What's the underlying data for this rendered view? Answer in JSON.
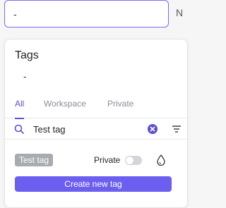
{
  "top_field": {
    "value": "-",
    "next_column_label": "N"
  },
  "tag_panel": {
    "title": "Tags",
    "current_value": "-",
    "tabs": [
      {
        "label": "All",
        "active": true
      },
      {
        "label": "Workspace",
        "active": false
      },
      {
        "label": "Private",
        "active": false
      }
    ],
    "search": {
      "value": "Test tag"
    },
    "result": {
      "tag_label": "Test tag",
      "private_label": "Private",
      "private_on": false
    },
    "create_button_label": "Create new tag"
  },
  "colors": {
    "accent": "#6c5ff0",
    "accent_dark": "#5b50d6",
    "tag_chip": "#a9abb2"
  },
  "icons": [
    "search-icon",
    "clear-icon",
    "filter-icon",
    "color-drop-icon"
  ]
}
